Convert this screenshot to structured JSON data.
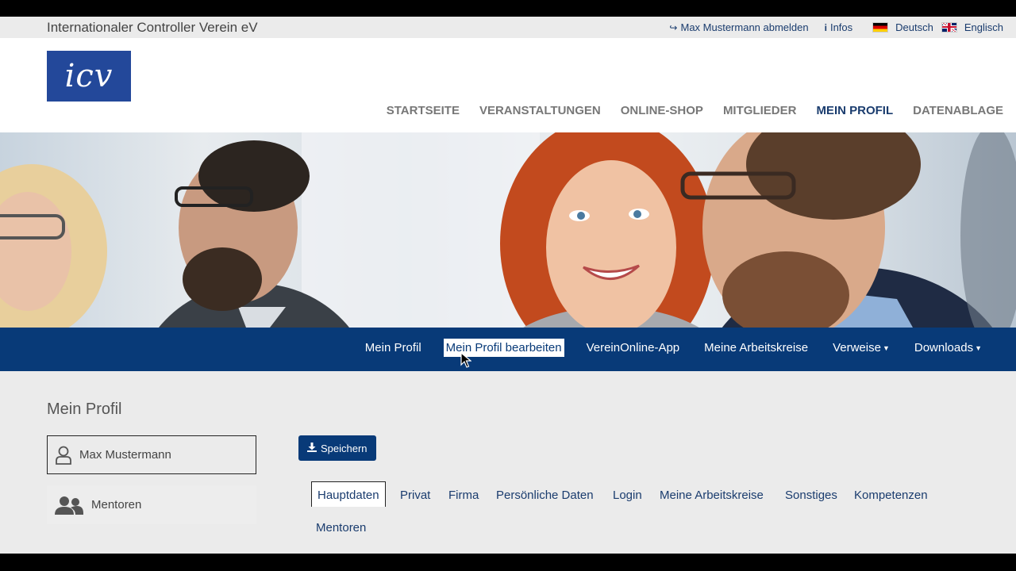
{
  "topbar": {
    "org_name": "Internationaler Controller Verein eV",
    "logout": "Max Mustermann abmelden",
    "info": "Infos",
    "lang_de": "Deutsch",
    "lang_en": "Englisch"
  },
  "logo": {
    "text": "icv"
  },
  "main_nav": {
    "items": [
      "STARTSEITE",
      "VERANSTALTUNGEN",
      "ONLINE-SHOP",
      "MITGLIEDER",
      "MEIN PROFIL",
      "DATENABLAGE"
    ],
    "active": "MEIN PROFIL"
  },
  "sub_nav": {
    "items": [
      "Mein Profil",
      "Mein Profil bearbeiten",
      "VereinOnline-App",
      "Meine Arbeitskreise",
      "Verweise",
      "Downloads"
    ],
    "active": "Mein Profil bearbeiten"
  },
  "content": {
    "page_title": "Mein Profil",
    "sidebar_profile": "Max Mustermann",
    "sidebar_mentors": "Mentoren",
    "save_label": "Speichern"
  },
  "tabs": {
    "items": [
      "Hauptdaten",
      "Privat",
      "Firma",
      "Persönliche Daten",
      "Login",
      "Meine Arbeitskreise",
      "Sonstiges",
      "Kompetenzen",
      "Mentoren"
    ],
    "active": "Hauptdaten"
  },
  "colors": {
    "brand_blue": "#083a78",
    "logo_blue": "#23489a",
    "nav_gray": "#777777",
    "page_bg": "#ebebeb"
  }
}
